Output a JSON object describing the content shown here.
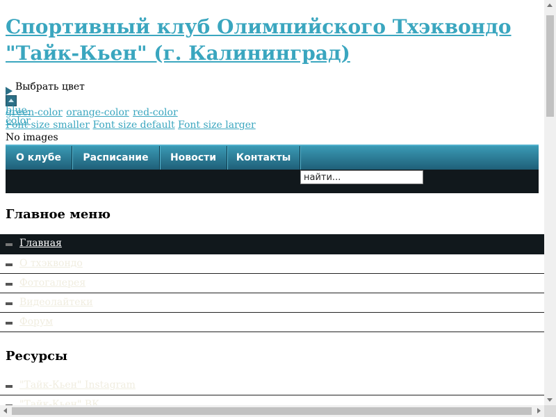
{
  "header": {
    "title": "Спортивный клуб Олимпийского Тхэквондо \"Тайк-Кьен\" (г. Калининград)"
  },
  "color_picker": {
    "label": "Выбрать цвет",
    "links": [
      "green-color",
      "orange-color",
      "red-color"
    ],
    "blue_link": "blue-color"
  },
  "font_controls": {
    "smaller": "Font size smaller",
    "default": "Font size default",
    "larger": "Font size larger"
  },
  "images_notice": "No images",
  "nav": {
    "items": [
      "О клубе",
      "Расписание",
      "Новости",
      "Контакты"
    ]
  },
  "search": {
    "value": "найти..."
  },
  "main_menu": {
    "title": "Главное меню",
    "items": [
      "Главная",
      "О тхэквондо",
      "Фотогалерея",
      "Видеолайтеки",
      "Форум"
    ]
  },
  "resources": {
    "title": "Ресурсы",
    "items": [
      "\"Тайк-Кьен\" Instagram",
      "\"Тайк-Кьен\" ВК"
    ]
  },
  "colors": {
    "link": "#3aa6bf",
    "nav_bg": "#2b7f99",
    "dark_bar": "#11181c"
  }
}
